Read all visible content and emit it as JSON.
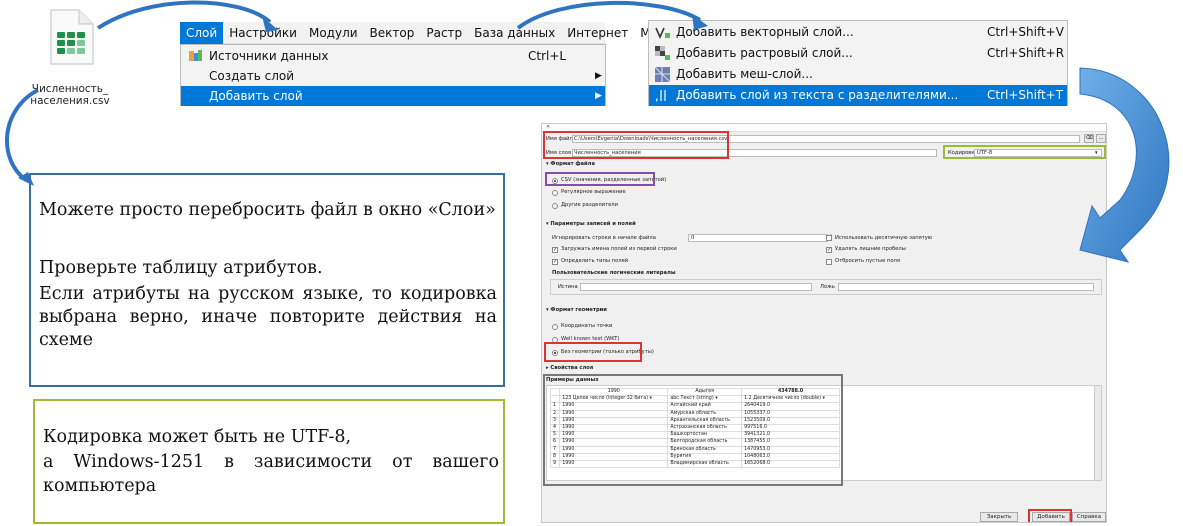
{
  "file": {
    "name_line1": "Численность_",
    "name_line2": "населения.csv"
  },
  "menubar": {
    "items": [
      "Слой",
      "Настройки",
      "Модули",
      "Вектор",
      "Растр",
      "База данных",
      "Интернет",
      "Меш"
    ]
  },
  "layer_menu": {
    "items": [
      {
        "label": "Источники данных",
        "shortcut": "Ctrl+L",
        "has_submenu": false,
        "selected": false
      },
      {
        "label": "Создать слой",
        "shortcut": "",
        "has_submenu": true,
        "selected": false
      },
      {
        "label": "Добавить слой",
        "shortcut": "",
        "has_submenu": true,
        "selected": true
      }
    ]
  },
  "add_layer_submenu": {
    "items": [
      {
        "label": "Добавить векторный слой...",
        "shortcut": "Ctrl+Shift+V",
        "icon": "vector-layer-icon",
        "selected": false
      },
      {
        "label": "Добавить растровый слой...",
        "shortcut": "Ctrl+Shift+R",
        "icon": "raster-layer-icon",
        "selected": false
      },
      {
        "label": "Добавить меш-слой...",
        "shortcut": "",
        "icon": "mesh-layer-icon",
        "selected": false
      },
      {
        "label": "Добавить слой из текста с разделителями...",
        "shortcut": "Ctrl+Shift+T",
        "icon": "delimited-text-icon",
        "selected": true
      }
    ]
  },
  "callout_blue": {
    "lines": [
      "Можете просто перебросить файл в окно «Слои»",
      "Проверьте таблицу атрибутов.",
      "Если атрибуты на русском языке, то кодировка выбрана верно, иначе повторите действия на схеме"
    ]
  },
  "callout_green": {
    "lines": [
      "Кодировка может быть не UTF-8,",
      "а Windows-1251 в зависимости от вашего компьютера"
    ]
  },
  "dialog": {
    "file_name_label": "Имя файла",
    "file_name_value": "C:\\Users\\Evgenia\\Downloads\\Численность_населения.csv",
    "layer_name_label": "Имя слоя",
    "layer_name_value": "Численность_населения",
    "encoding_label": "Кодировка",
    "encoding_value": "UTF-8",
    "file_format": {
      "title": "Формат файла",
      "options": [
        "CSV (значения, разделенные запятой)",
        "Регулярное выражение",
        "Другие разделители"
      ]
    },
    "record_options": {
      "title": "Параметры записей и полей",
      "skip_rows_label": "Игнорировать строки в начале файла",
      "skip_rows_value": "0",
      "decimal_comma": "Использовать десятичную запятую",
      "first_record_headers": "Загружать имена полей из первой строки",
      "trim_fields": "Удалять лишние пробелы",
      "detect_types": "Определить типы полей",
      "discard_empty": "Отбросить пустые поля",
      "custom_booleans": "Пользовательские логические литералы",
      "true_label": "Истина",
      "false_label": "Ложь"
    },
    "geometry": {
      "title": "Формат геометрии",
      "options": [
        "Координаты точки",
        "Well known text (WKT)",
        "Без геометрии (только атрибуты)"
      ]
    },
    "layer_settings": "Свойства слоя",
    "sample_data": {
      "title": "Примеры данных",
      "headers": [
        "1990",
        "Адыгея",
        "434788.0"
      ],
      "types": [
        "123 Целое число (integer 32 бита)",
        "abc Текст (string)",
        "1.2 Десятичное число (double)"
      ],
      "rows": [
        [
          "1",
          "1990",
          "Алтайский край",
          "2640419.0"
        ],
        [
          "2",
          "1990",
          "Амурская область",
          "1055337.0"
        ],
        [
          "3",
          "1990",
          "Архангельская область",
          "1523509.0"
        ],
        [
          "4",
          "1990",
          "Астраханская область",
          "997516.0"
        ],
        [
          "5",
          "1990",
          "Башкортостан",
          "3941321.0"
        ],
        [
          "6",
          "1990",
          "Белгородская область",
          "1387455.0"
        ],
        [
          "7",
          "1990",
          "Брянская область",
          "1470953.0"
        ],
        [
          "8",
          "1990",
          "Бурятия",
          "1048063.0"
        ],
        [
          "9",
          "1990",
          "Владимирская область",
          "1652068.0"
        ]
      ]
    },
    "buttons": {
      "close": "Закрыть",
      "add": "Добавить",
      "help": "Справка"
    }
  }
}
